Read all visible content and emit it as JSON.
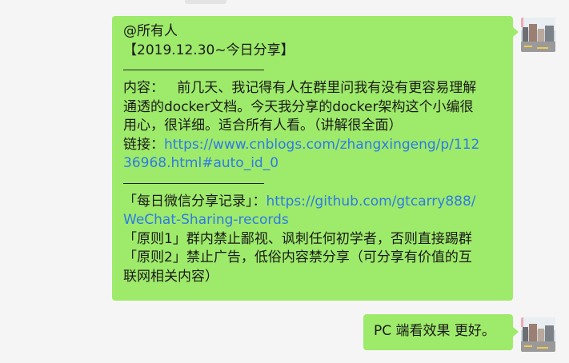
{
  "message1": {
    "mention": "@所有人",
    "title": "【2019.12.30~今日分享】",
    "content_prefix": "内容：",
    "content_line1": "   前几天、我记得有人在群里问我有没有更容易理解",
    "content_line2": "通透的docker文档。今天我分享的docker架构这个小编很",
    "content_line3": "用心，很详细。适合所有人看。（讲解很全面）",
    "link_prefix": "链接：",
    "link_line1": "https://www.cnblogs.com/zhangxingeng/p/112",
    "link_line2": "36968.html#auto_id_0",
    "record_prefix": "「每日微信分享记录」：",
    "record_link1": "https://github.com/gtcarry888/",
    "record_link2": "WeChat-Sharing-records",
    "rule1": "「原则1」群内禁止鄙视、讽刺任何初学者，否则直接踢群",
    "rule2_line1": "「原则2」禁止广告，低俗内容禁分享（可分享有价值的互",
    "rule2_line2": "联网相关内容）"
  },
  "message2": {
    "text": "PC 端看效果 更好。"
  },
  "colors": {
    "bubble": "#9eea6a",
    "link": "#2d7be6",
    "background": "#f5f5f5"
  }
}
